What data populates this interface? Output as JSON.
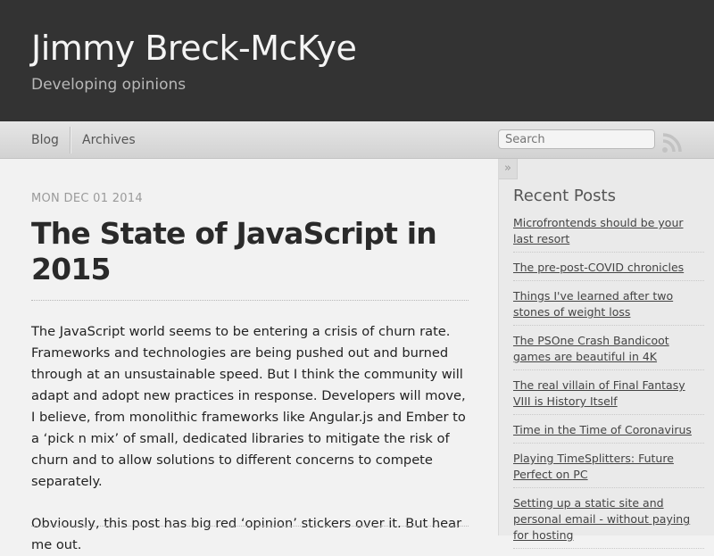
{
  "site": {
    "title": "Jimmy Breck-McKye",
    "tagline": "Developing opinions"
  },
  "nav": {
    "blog": "Blog",
    "archives": "Archives",
    "search_placeholder": "Search"
  },
  "post": {
    "date": "MON DEC 01 2014",
    "title": "The State of JavaScript in 2015",
    "paragraphs": [
      "The JavaScript world seems to be entering a crisis of churn rate. Frameworks and technologies are being pushed out and burned through at an unsustainable speed. But I think the community will adapt and adopt new practices in response. Developers will move, I believe, from monolithic frameworks like Angular.js and Ember to a ‘pick n mix’ of small, dedicated libraries to mitigate the risk of churn and to allow solutions to different concerns to compete separately.",
      "Obviously, this post has big red ‘opinion’ stickers over it. But hear me out."
    ]
  },
  "sidebar": {
    "toggle": "»",
    "recent_title": "Recent Posts",
    "recent_posts": [
      "Microfrontends should be your last resort",
      "The pre-post-COVID chronicles",
      "Things I've learned after two stones of weight loss",
      "The PSOne Crash Bandicoot games are beautiful in 4K",
      "The real villain of Final Fantasy VIII is History Itself",
      "Time in the Time of Coronavirus",
      "Playing TimeSplitters: Future Perfect on PC",
      "Setting up a static site and personal email - without paying for hosting"
    ]
  },
  "icons": {
    "rss": "rss-icon"
  }
}
